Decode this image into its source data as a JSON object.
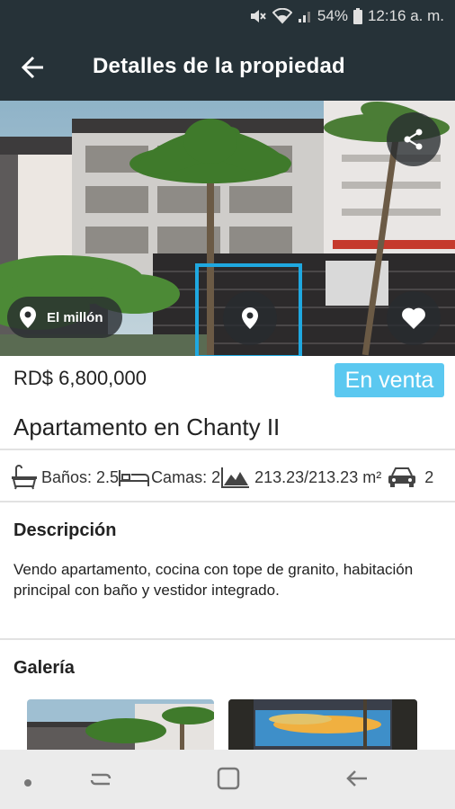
{
  "status_bar": {
    "battery": "54%",
    "time": "12:16 a. m."
  },
  "app_bar": {
    "title": "Detalles de la propiedad"
  },
  "hero": {
    "location_label": "El millón"
  },
  "property": {
    "price": "RD$ 6,800,000",
    "status": "En venta",
    "title": "Apartamento en Chanty II"
  },
  "features": [
    {
      "icon": "bathtub-icon",
      "label": "Baños: 2.5"
    },
    {
      "icon": "bed-icon",
      "label": "Camas: 2"
    },
    {
      "icon": "area-icon",
      "label": "213.23/213.23 m²"
    },
    {
      "icon": "car-icon",
      "label": "2"
    }
  ],
  "description": {
    "heading": "Descripción",
    "text": "Vendo apartamento, cocina con tope de granito, habitación principal con baño y vestidor integrado."
  },
  "gallery": {
    "heading": "Galería"
  },
  "colors": {
    "app_bar": "#263238",
    "accent": "#1fa8e0",
    "badge": "#5bc8f0"
  }
}
